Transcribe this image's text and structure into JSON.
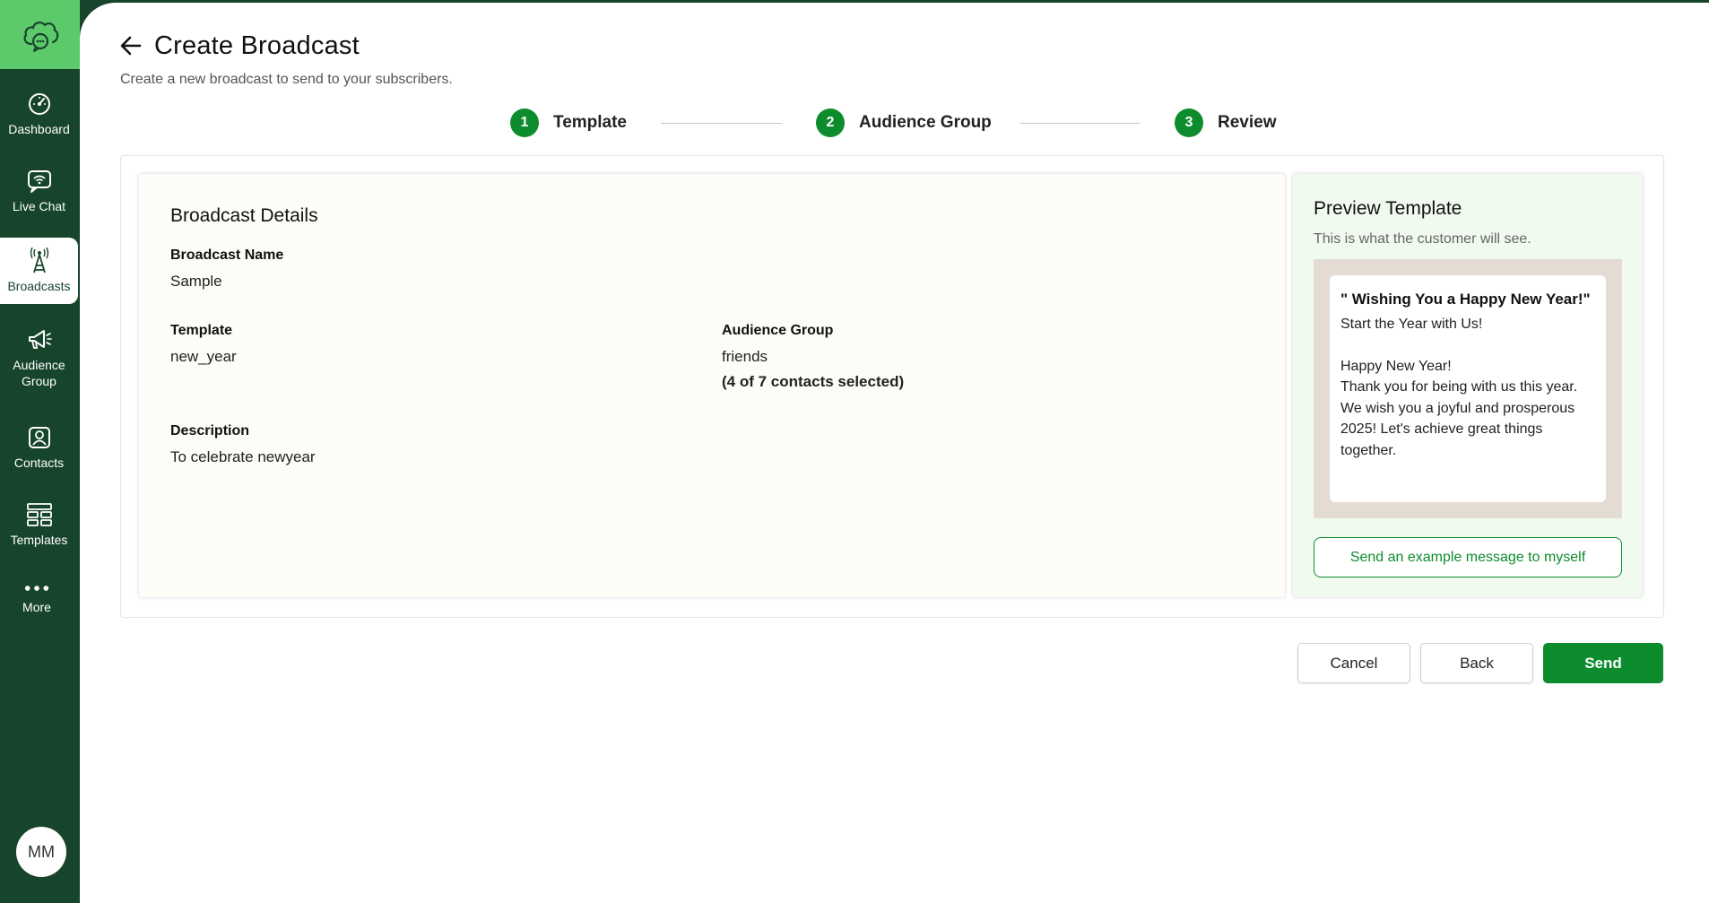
{
  "sidebar": {
    "logo_icon": "cloud-chat-icon",
    "items": [
      {
        "label": "Dashboard",
        "icon": "gauge-icon"
      },
      {
        "label": "Live Chat",
        "icon": "chat-wifi-icon"
      },
      {
        "label": "Broadcasts",
        "icon": "broadcast-tower-icon"
      },
      {
        "label": "Audience\nGroup",
        "icon": "megaphone-icon"
      },
      {
        "label": "Contacts",
        "icon": "contact-card-icon"
      },
      {
        "label": "Templates",
        "icon": "templates-grid-icon"
      },
      {
        "label": "More",
        "icon": "more-dots-icon"
      }
    ],
    "avatar": "MM"
  },
  "header": {
    "title": "Create Broadcast",
    "subtitle": "Create a new broadcast to send to your subscribers."
  },
  "stepper": [
    {
      "number": "1",
      "label": "Template"
    },
    {
      "number": "2",
      "label": "Audience Group"
    },
    {
      "number": "3",
      "label": "Review"
    }
  ],
  "details": {
    "heading": "Broadcast Details",
    "broadcast_name_label": "Broadcast Name",
    "broadcast_name_value": "Sample",
    "template_label": "Template",
    "template_value": "new_year",
    "audience_label": "Audience Group",
    "audience_value": "friends",
    "audience_count": "(4 of 7 contacts selected)",
    "description_label": "Description",
    "description_value": "To celebrate newyear"
  },
  "preview": {
    "heading": "Preview Template",
    "subtitle": "This is what the customer will see.",
    "message_title": "\" Wishing You a Happy New Year!\"",
    "message_line1": "Start the Year with Us!",
    "message_body": [
      "Happy New Year!",
      "Thank you for being with us this year.",
      "We wish you a joyful and prosperous 2025! Let's achieve great things together."
    ],
    "send_example_label": "Send an example message to myself"
  },
  "actions": {
    "cancel": "Cancel",
    "back": "Back",
    "send": "Send"
  },
  "colors": {
    "sidebar_bg": "#17452c",
    "logo_bg": "#5cc96b",
    "accent": "#0d8c2e"
  }
}
